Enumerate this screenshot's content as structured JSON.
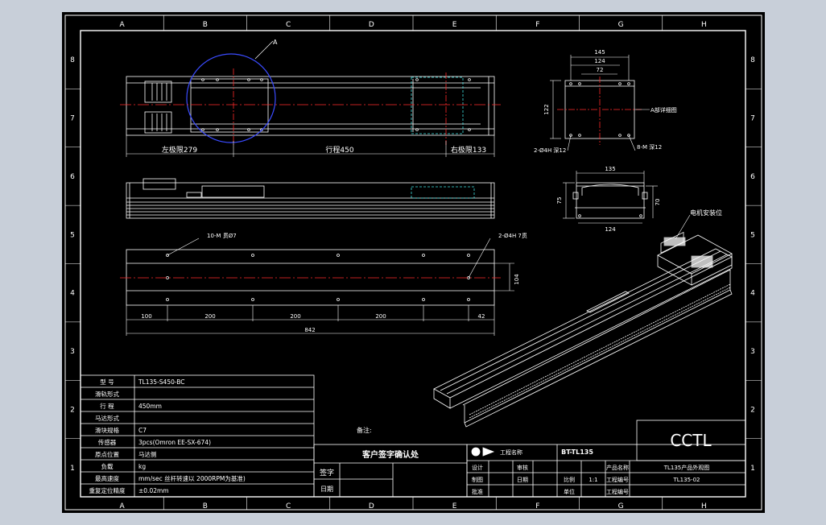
{
  "grid": {
    "columns": [
      "A",
      "B",
      "C",
      "D",
      "E",
      "F",
      "G",
      "H"
    ],
    "rows": [
      "8",
      "7",
      "6",
      "5",
      "4",
      "3",
      "2",
      "1"
    ]
  },
  "top_view": {
    "detail_label": "A",
    "left_limit": "左极限279",
    "stroke": "行程450",
    "right_limit": "右极限133"
  },
  "end_view": {
    "dim_145": "145",
    "dim_124": "124",
    "dim_72": "72",
    "dim_122": "122",
    "detail_ref": "A部详细图",
    "hole_left": "2-Ø4H 深12",
    "hole_right": "8-M 深12"
  },
  "section_view": {
    "dim_135": "135",
    "dim_75": "75",
    "dim_70": "70",
    "dim_124": "124"
  },
  "bottom_view": {
    "holes_left": "10-M 贯Ø7",
    "holes_right": "2-Ø4H 7贯",
    "dim_104": "104",
    "segments": [
      "100",
      "200",
      "200",
      "200",
      "42"
    ],
    "overall": "842"
  },
  "iso_view": {
    "motor_label": "电机安装位"
  },
  "spec_table": {
    "rows": [
      {
        "label": "型 号",
        "value": "TL135-S450-BC"
      },
      {
        "label": "滑轨形式",
        "value": ""
      },
      {
        "label": "行 程",
        "value": "450mm"
      },
      {
        "label": "马达形式",
        "value": ""
      },
      {
        "label": "滑块规格",
        "value": "C7"
      },
      {
        "label": "传感器",
        "value": "3pcs(Omron EE-SX-674)"
      },
      {
        "label": "原点位置",
        "value": "马达侧"
      },
      {
        "label": "负载",
        "value": "kg"
      },
      {
        "label": "最高速度",
        "value": "mm/sec 丝杆转速以 2000RPM为基准)"
      },
      {
        "label": "重复定位精度",
        "value": "±0.02mm"
      }
    ]
  },
  "notes_label": "备注:",
  "approval": {
    "title": "客户签字确认处",
    "sign_label": "签字",
    "date_label": "日期"
  },
  "title_block": {
    "brand": "CCTL",
    "project_label": "工程名称",
    "project_value": "BT-TL135",
    "design_label": "设计",
    "check_label": "审核",
    "product_label": "产品名称",
    "product_value": "TL135产品外观图",
    "drawing_label": "制图",
    "date_label": "日期",
    "scale_label": "比例",
    "scale_value": "1:1",
    "drawing_no_label": "工程编号",
    "drawing_no_value": "TL135-02",
    "approve_label": "批准",
    "unit_label": "单位",
    "sheet_label": "工程编号"
  }
}
